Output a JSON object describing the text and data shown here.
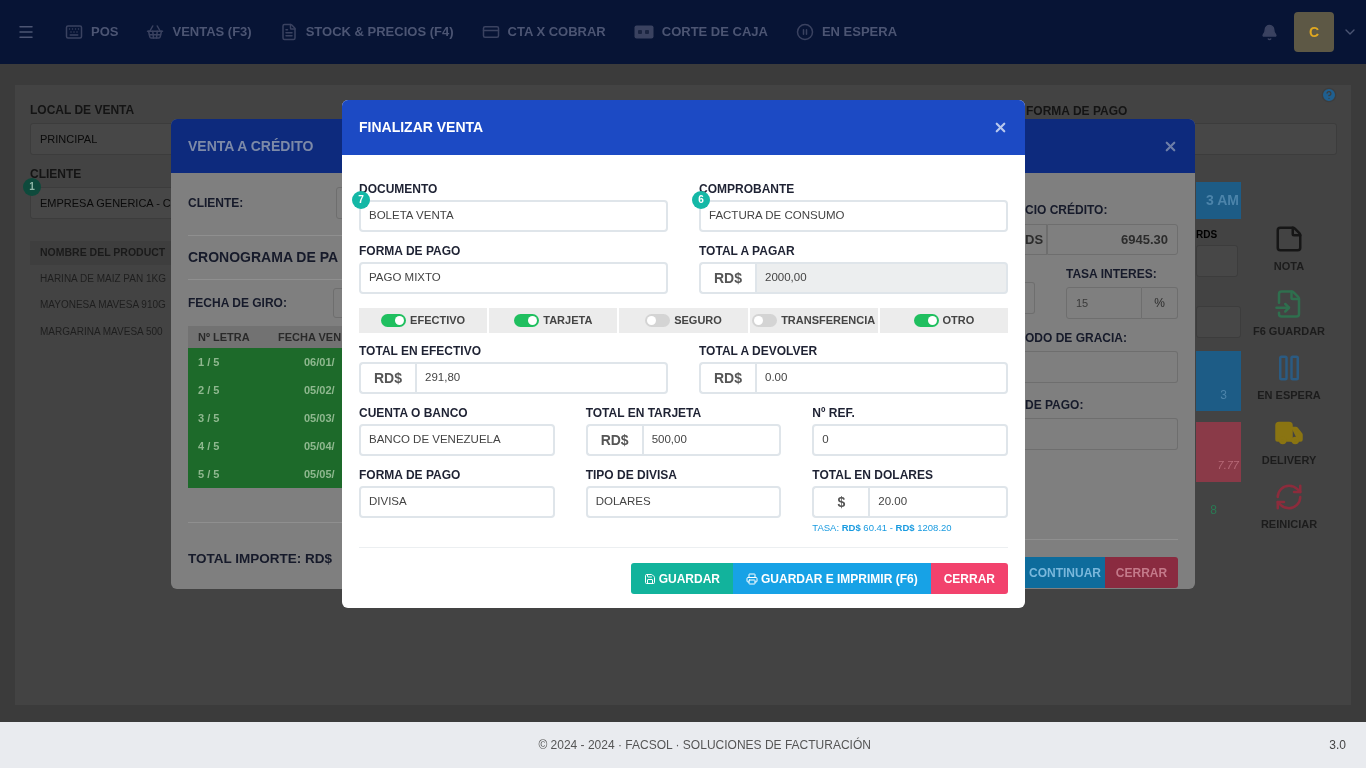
{
  "navbar": {
    "items": [
      {
        "label": "POS"
      },
      {
        "label": "VENTAS (F3)"
      },
      {
        "label": "STOCK & PRECIOS (F4)"
      },
      {
        "label": "CTA X COBRAR"
      },
      {
        "label": "CORTE DE CAJA"
      },
      {
        "label": "EN ESPERA"
      }
    ],
    "avatar": "C"
  },
  "page": {
    "local_label": "LOCAL DE VENTA",
    "local_value": "PRINCIPAL",
    "cliente_label": "CLIENTE",
    "cliente_badge": "1",
    "cliente_value": "EMPRESA GENERICA - C",
    "table_header": "NOMBRE DEL PRODUCT",
    "products": [
      "HARINA DE MAIZ PAN 1KG",
      "MAYONESA MAVESA 910G",
      "MARGARINA MAVESA 500"
    ],
    "forma_pago_label": "FORMA DE PAGO",
    "time_tile": "3 AM",
    "rds_label": "RDS",
    "blue_tile": "3",
    "red_tile": "7.77",
    "green_text": "8",
    "actions": [
      {
        "label": "NOTA"
      },
      {
        "label": "F6 GUARDAR"
      },
      {
        "label": "EN ESPERA"
      },
      {
        "label": "DELIVERY"
      },
      {
        "label": "REINICIAR"
      }
    ]
  },
  "credit_modal": {
    "title": "VENTA A CRÉDITO",
    "cliente_label": "CLIENTE:",
    "schedule_title": "CRONOGRAMA DE PA",
    "fecha_label": "FECHA DE GIRO:",
    "columns": [
      "Nº LETRA",
      "FECHA VEN"
    ],
    "rows": [
      [
        "1 / 5",
        "06/01/"
      ],
      [
        "2 / 5",
        "05/02/"
      ],
      [
        "3 / 5",
        "05/03/"
      ],
      [
        "4 / 5",
        "05/04/"
      ],
      [
        "5 / 5",
        "05/05/"
      ]
    ],
    "total_label": "TOTAL IMPORTE: RD$",
    "precio_label": "CIO CRÉDITO:",
    "precio_addon": "DS",
    "precio_value": "6945.30",
    "tasa_label": "TASA INTERES:",
    "tasa_value": "15",
    "tasa_addon": "%",
    "gracia_label": "ODO DE GRACIA:",
    "pago_label": "DE PAGO:",
    "buttons": [
      {
        "kind": "primary",
        "label": "CONTINUAR"
      },
      {
        "kind": "danger",
        "label": "CERRAR"
      }
    ]
  },
  "modal": {
    "title": "FINALIZAR VENTA",
    "documento": {
      "label": "DOCUMENTO",
      "badge": "7",
      "value": "BOLETA VENTA"
    },
    "comprobante": {
      "label": "COMPROBANTE",
      "badge": "6",
      "value": "FACTURA DE CONSUMO"
    },
    "forma_pago": {
      "label": "FORMA DE PAGO",
      "value": "PAGO MIXTO"
    },
    "total_pagar": {
      "label": "TOTAL A PAGAR",
      "addon": "RD$",
      "value": "2000,00",
      "disabled": true
    },
    "payment_methods": [
      {
        "label": "EFECTIVO",
        "on": true
      },
      {
        "label": "TARJETA",
        "on": true
      },
      {
        "label": "SEGURO",
        "on": false
      },
      {
        "label": "TRANSFERENCIA",
        "on": false
      },
      {
        "label": "OTRO",
        "on": true
      }
    ],
    "total_efectivo": {
      "label": "TOTAL EN EFECTIVO",
      "addon": "RD$",
      "value": "291,80"
    },
    "total_devolver": {
      "label": "TOTAL A DEVOLVER",
      "addon": "RD$",
      "value": "0.00"
    },
    "cuenta": {
      "label": "CUENTA O BANCO",
      "value": "BANCO DE VENEZUELA"
    },
    "total_tarjeta": {
      "label": "TOTAL EN TARJETA",
      "addon": "RD$",
      "value": "500,00"
    },
    "ref": {
      "label": "Nº REF.",
      "value": "0"
    },
    "forma_pago_2": {
      "label": "FORMA DE PAGO",
      "value": "DIVISA"
    },
    "divisa": {
      "label": "TIPO DE DIVISA",
      "value": "DOLARES"
    },
    "total_dolares": {
      "label": "TOTAL EN DOLARES",
      "addon": "$",
      "value": "20.00"
    },
    "tasa": "TASA: **RD$** 60.41 - **RD$** 1208.20",
    "buttons": [
      {
        "kind": "save",
        "label": "GUARDAR"
      },
      {
        "kind": "print",
        "label": "GUARDAR E IMPRIMIR (F6)"
      },
      {
        "kind": "close",
        "label": "CERRAR"
      }
    ]
  },
  "footer": {
    "text": "© 2024 - 2024 · FACSOL · SOLUCIONES DE FACTURACIÓN",
    "version": "3.0"
  }
}
